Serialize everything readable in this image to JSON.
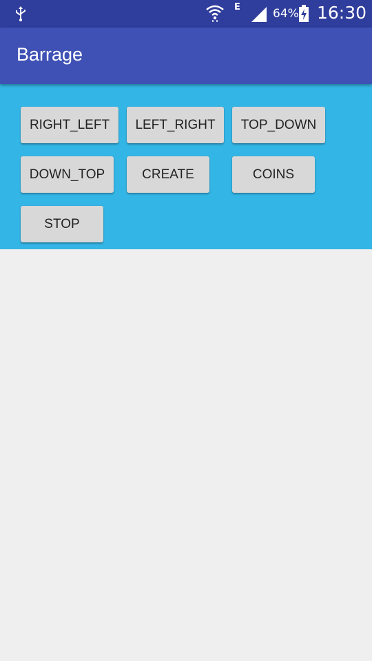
{
  "status_bar": {
    "icons": [
      "usb-icon",
      "wifi-icon",
      "network-type-icon",
      "signal-icon",
      "battery-charging-icon"
    ],
    "network_type": "E",
    "battery_percent": "64%",
    "time": "16:30"
  },
  "app_bar": {
    "title": "Barrage",
    "color": "#3f51b5"
  },
  "panel": {
    "color": "#33b5e5",
    "buttons": [
      {
        "label": "RIGHT_LEFT"
      },
      {
        "label": "LEFT_RIGHT"
      },
      {
        "label": "TOP_DOWN"
      },
      {
        "label": "DOWN_TOP"
      },
      {
        "label": "CREATE"
      },
      {
        "label": "COINS"
      },
      {
        "label": "STOP"
      }
    ]
  }
}
